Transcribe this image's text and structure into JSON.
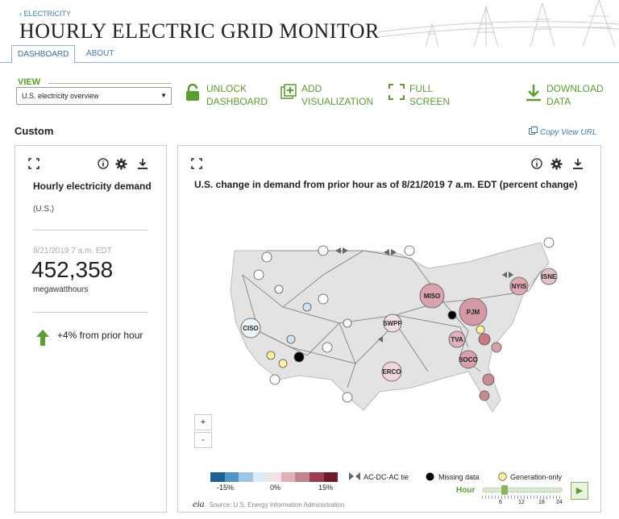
{
  "breadcrumb": "‹ ELECTRICITY",
  "title": "HOURLY ELECTRIC GRID MONITOR",
  "tabs": [
    {
      "label": "DASHBOARD"
    },
    {
      "label": "ABOUT"
    }
  ],
  "toolbar": {
    "view_label": "VIEW",
    "view_value": "U.S. electricity overview",
    "unlock": [
      "UNLOCK",
      "DASHBOARD"
    ],
    "add": [
      "ADD",
      "VISUALIZATION"
    ],
    "full": [
      "FULL",
      "SCREEN"
    ],
    "download": [
      "DOWNLOAD",
      "DATA"
    ]
  },
  "section_title": "Custom",
  "copy_url": "Copy View URL",
  "metric": {
    "title": "Hourly electricity demand",
    "region": "(U.S.)",
    "date": "8/21/2019 7 a.m. EDT",
    "value": "452,358",
    "unit": "megawatthours",
    "change": "+4% from prior hour"
  },
  "map_panel": {
    "title": "U.S. change in demand from prior hour as of 8/21/2019 7 a.m. EDT (percent change)",
    "nodes": [
      "CISO",
      "SWPP",
      "ERCO",
      "MISO",
      "PJM",
      "TVA",
      "SOCO",
      "NYIS",
      "ISNE"
    ],
    "zoom_in": "+",
    "zoom_out": "-",
    "legend": {
      "ticks": [
        "-15%",
        "0%",
        "15%"
      ],
      "tie": "AC-DC-AC tie",
      "missing": "Missing data",
      "generation": "Generation-only"
    },
    "source": "Source: U.S. Energy Information Administration",
    "source_logo": "eia",
    "hour_label": "Hour",
    "hour_ticks": [
      "6",
      "12",
      "18",
      "24"
    ],
    "colors": {
      "accent": "#5a9e2f",
      "link": "#3a7fb0"
    }
  }
}
